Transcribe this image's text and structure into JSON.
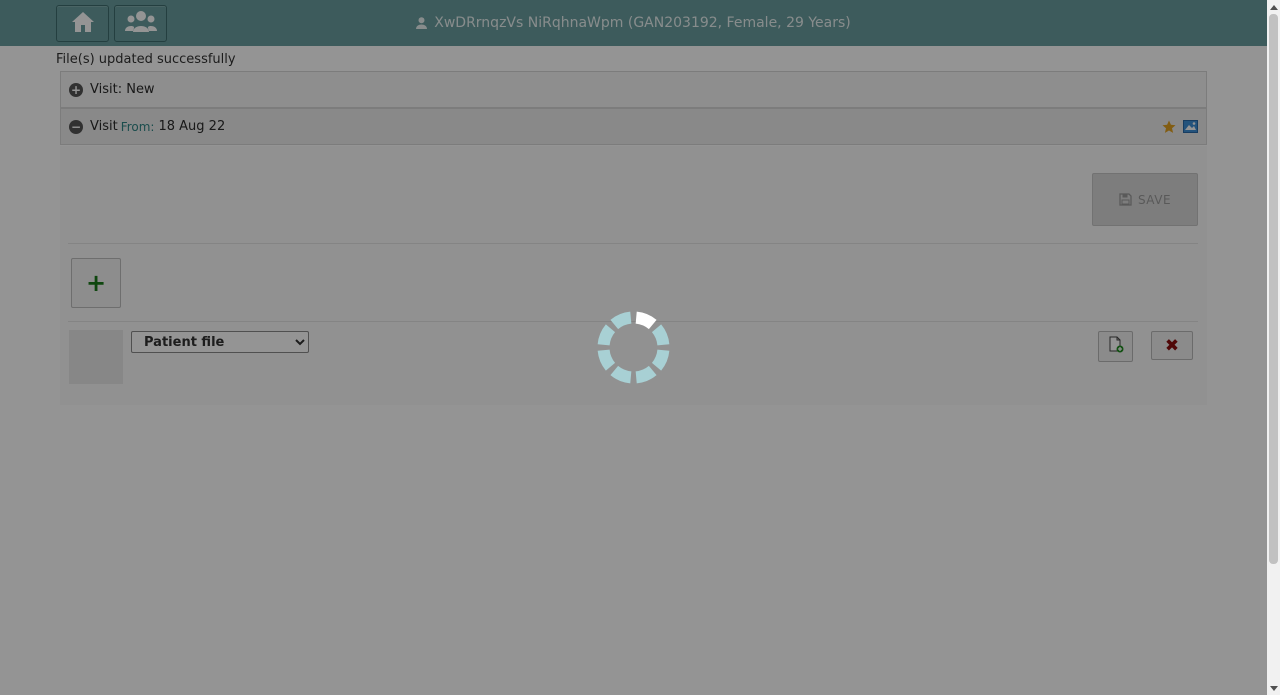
{
  "header": {
    "patient_title": "XwDRrnqzVs NiRqhnaWpm (GAN203192, Female, 29 Years)",
    "home_icon": "home-icon",
    "patients_icon": "users-icon",
    "user_icon": "user-icon",
    "background_color": "#6a9e9f"
  },
  "notice": "File(s) updated successfully",
  "visits": {
    "new_label": "Visit: New",
    "current": {
      "label": "Visit",
      "from_label": "From:",
      "date": "18 Aug 22",
      "icons": [
        "star-icon",
        "image-icon"
      ]
    }
  },
  "panel": {
    "save_label": "SAVE",
    "add_label": "+",
    "file_type_selected": "Patient file",
    "file_type_options": [
      "Patient file"
    ],
    "remove_label": "✖"
  },
  "loading": {
    "spinner_color": "#a8d0d4"
  }
}
